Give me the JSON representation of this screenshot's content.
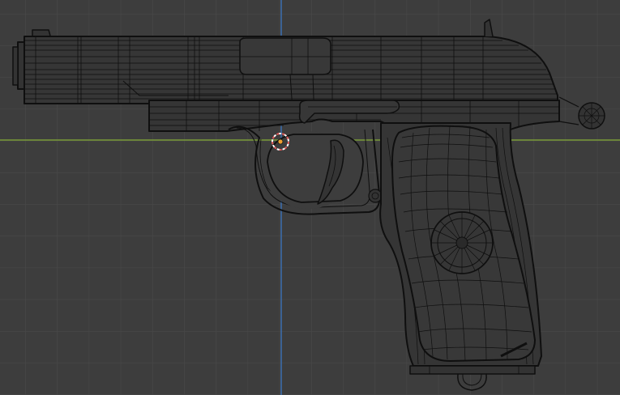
{
  "viewport": {
    "view": "orthographic-side",
    "shading": "wireframe",
    "colors": {
      "background": "#3d3d3d",
      "grid": "#4a4a4a",
      "x_axis": "#7a9b38",
      "z_axis": "#3b6fb0",
      "wire": "#101010",
      "wire_fill": "#353535",
      "origin": "#f0a030",
      "cursor_ring": "#e05858"
    }
  },
  "scene": {
    "objects": [
      {
        "name_icon": "pistol-model-icon",
        "kind": "mesh",
        "selected": false
      }
    ],
    "gizmos": [
      "3d-cursor-icon",
      "object-origin-icon"
    ]
  }
}
